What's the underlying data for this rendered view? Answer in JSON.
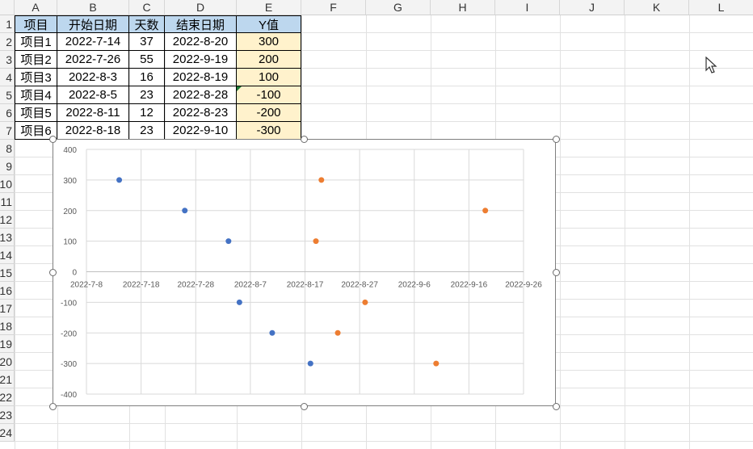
{
  "spreadsheet": {
    "column_headers": [
      "A",
      "B",
      "C",
      "D",
      "E",
      "F",
      "G",
      "H",
      "I",
      "J",
      "K",
      "L"
    ],
    "row_headers": [
      "1",
      "2",
      "3",
      "4",
      "5",
      "6",
      "7",
      "8",
      "9",
      "10",
      "11",
      "12",
      "13",
      "14",
      "15",
      "16",
      "17",
      "18",
      "19",
      "20",
      "21",
      "22",
      "23",
      "24"
    ],
    "table": {
      "headers": [
        "项目",
        "开始日期",
        "天数",
        "结束日期",
        "Y值"
      ],
      "rows": [
        [
          "项目1",
          "2022-7-14",
          "37",
          "2022-8-20",
          "300"
        ],
        [
          "项目2",
          "2022-7-26",
          "55",
          "2022-9-19",
          "200"
        ],
        [
          "项目3",
          "2022-8-3",
          "16",
          "2022-8-19",
          "100"
        ],
        [
          "项目4",
          "2022-8-5",
          "23",
          "2022-8-28",
          "-100"
        ],
        [
          "项目5",
          "2022-8-11",
          "12",
          "2022-8-23",
          "-200"
        ],
        [
          "项目6",
          "2022-8-18",
          "23",
          "2022-9-10",
          "-300"
        ]
      ]
    },
    "colors": {
      "header_fill": "#bdd7ee",
      "y_fill": "#fff2cc"
    }
  },
  "chart_data": {
    "type": "scatter",
    "x_tick_labels": [
      "2022-7-8",
      "2022-7-18",
      "2022-7-28",
      "2022-8-7",
      "2022-8-17",
      "2022-8-27",
      "2022-9-6",
      "2022-9-16",
      "2022-9-26"
    ],
    "y_tick_labels": [
      "400",
      "300",
      "200",
      "100",
      "0",
      "-100",
      "-200",
      "-300",
      "-400"
    ],
    "ylim": [
      -400,
      400
    ],
    "xlim": [
      "2022-7-8",
      "2022-9-26"
    ],
    "grid": true,
    "series": [
      {
        "color": "#4472c4",
        "points": [
          {
            "x": "2022-7-14",
            "y": 300
          },
          {
            "x": "2022-7-26",
            "y": 200
          },
          {
            "x": "2022-8-3",
            "y": 100
          },
          {
            "x": "2022-8-5",
            "y": -100
          },
          {
            "x": "2022-8-11",
            "y": -200
          },
          {
            "x": "2022-8-18",
            "y": -300
          }
        ]
      },
      {
        "color": "#ed7d31",
        "points": [
          {
            "x": "2022-8-20",
            "y": 300
          },
          {
            "x": "2022-9-19",
            "y": 200
          },
          {
            "x": "2022-8-19",
            "y": 100
          },
          {
            "x": "2022-8-28",
            "y": -100
          },
          {
            "x": "2022-8-23",
            "y": -200
          },
          {
            "x": "2022-9-10",
            "y": -300
          }
        ]
      }
    ]
  },
  "icons": {
    "cursor": "mouse-pointer-icon"
  }
}
